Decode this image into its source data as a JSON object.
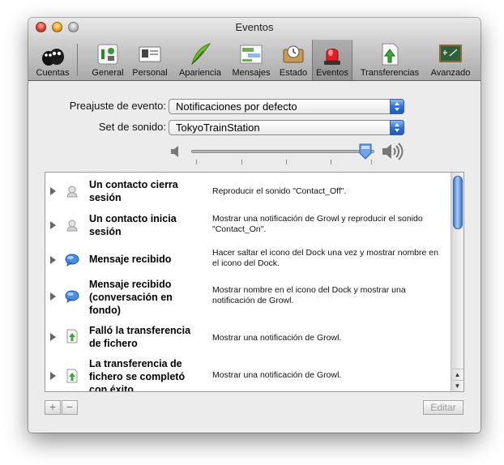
{
  "window": {
    "title": "Eventos"
  },
  "toolbar": {
    "items": [
      {
        "label": "Cuentas",
        "icon": "accounts-icon"
      },
      {
        "label": "General",
        "icon": "general-icon"
      },
      {
        "label": "Personal",
        "icon": "personal-icon"
      },
      {
        "label": "Apariencia",
        "icon": "appearance-icon"
      },
      {
        "label": "Mensajes",
        "icon": "messages-icon"
      },
      {
        "label": "Estado",
        "icon": "status-icon"
      },
      {
        "label": "Eventos",
        "icon": "alarm-icon"
      },
      {
        "label": "Transferencias",
        "icon": "transfers-icon"
      },
      {
        "label": "Avanzado",
        "icon": "advanced-icon"
      }
    ],
    "selected": "Eventos"
  },
  "form": {
    "preset_label": "Preajuste de evento:",
    "preset_value": "Notificaciones por defecto",
    "sound_label": "Set de sonido:",
    "sound_value": "TokyoTrainStation",
    "volume_level": 0.95
  },
  "events": [
    {
      "name": "Un contacto cierra sesión",
      "action": "Reproducir el sonido \"Contact_Off\".",
      "icon": "contact-offline-icon"
    },
    {
      "name": "Un contacto inicia sesión",
      "action": "Mostrar una notificación de Growl y reproducir el sonido \"Contact_On\".",
      "icon": "contact-online-icon"
    },
    {
      "name": "Mensaje recibido",
      "action": "Hacer saltar el icono del Dock una vez y mostrar nombre en el icono del Dock.",
      "icon": "message-bubble-icon"
    },
    {
      "name": "Mensaje recibido (conversación en fondo)",
      "action": "Mostrar nombre en el icono del Dock y mostrar una notificación de Growl.",
      "icon": "message-bubble-icon"
    },
    {
      "name": "Falló la transferencia de fichero",
      "action": "Mostrar una notificación de Growl.",
      "icon": "file-transfer-icon"
    },
    {
      "name": "La transferencia de fichero se completó con éxito",
      "action": "Mostrar una notificación de Growl.",
      "icon": "file-transfer-icon"
    }
  ],
  "buttons": {
    "add": "+",
    "remove": "−",
    "edit": "Editar"
  },
  "scrollbar": {
    "up": "▲",
    "down": "▼"
  },
  "colors": {
    "accent": "#2f72d8",
    "toolbar_bg": "#bdbdbd"
  }
}
